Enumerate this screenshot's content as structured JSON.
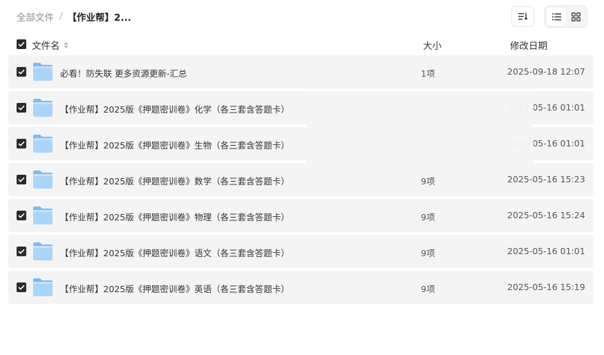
{
  "breadcrumb": {
    "root": "全部文件",
    "separator": "/",
    "current": "【作业帮】2..."
  },
  "toolbar": {
    "sort_icon": "sort-icon",
    "list_view_icon": "list-view-icon",
    "grid_view_icon": "grid-view-icon",
    "active_view": "list"
  },
  "columns": {
    "name": "文件名",
    "size": "大小",
    "date": "修改日期"
  },
  "colors": {
    "folder": "#8cc6f6",
    "checkbox": "#2b2b2b",
    "row_background": "#f4f4f5"
  },
  "files": [
    {
      "name": "必看！防失联 更多资源更新-汇总",
      "size": "1项",
      "date": "2025-09-18 12:07",
      "checked": true
    },
    {
      "name": "【作业帮】2025版《押题密训卷》化学（各三套含答题卡）",
      "size": "",
      "date": "2025-05-16 01:01",
      "checked": true
    },
    {
      "name": "【作业帮】2025版《押题密训卷》生物（各三套含答题卡）",
      "size": "",
      "date": "2025-05-16 01:01",
      "checked": true
    },
    {
      "name": "【作业帮】2025版《押题密训卷》数学（各三套含答题卡）",
      "size": "9项",
      "date": "2025-05-16 15:23",
      "checked": true
    },
    {
      "name": "【作业帮】2025版《押题密训卷》物理（各三套含答题卡）",
      "size": "9项",
      "date": "2025-05-16 15:24",
      "checked": true
    },
    {
      "name": "【作业帮】2025版《押题密训卷》语文（各三套含答题卡）",
      "size": "9项",
      "date": "2025-05-16 01:01",
      "checked": true
    },
    {
      "name": "【作业帮】2025版《押题密训卷》英语（各三套含答题卡）",
      "size": "9项",
      "date": "2025-05-16 15:19",
      "checked": true
    }
  ]
}
